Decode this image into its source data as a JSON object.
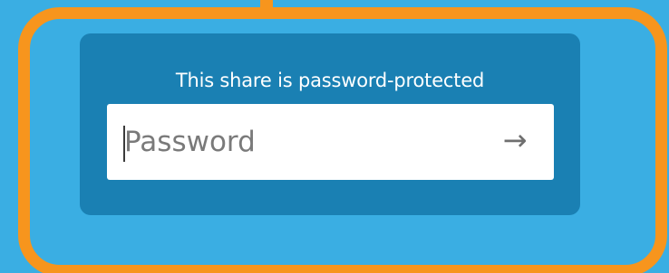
{
  "dialog": {
    "title": "This share is password-protected",
    "password_placeholder": "Password",
    "password_value": "",
    "submit_icon": "arrow-right-icon",
    "submit_glyph": "→"
  },
  "colors": {
    "background": "#3aaee3",
    "highlight": "#f7951d",
    "dialog": "#1a80b3",
    "input": "#ffffff"
  }
}
